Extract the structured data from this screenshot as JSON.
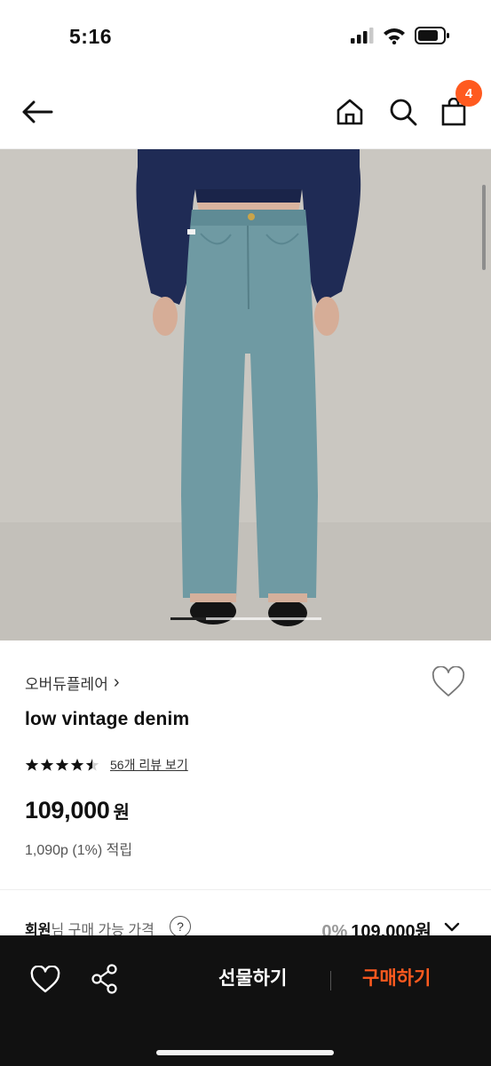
{
  "status": {
    "time": "5:16"
  },
  "nav": {
    "cart_count": "4"
  },
  "product": {
    "brand": "오버듀플레어",
    "brand_chevron": "›",
    "name": "low vintage denim",
    "rating": 4.5,
    "review_link": "56개 리뷰 보기",
    "price": "109,000",
    "price_unit": "원",
    "points": "1,090p (1%) 적립",
    "image_index": 1
  },
  "member_price": {
    "label_bold": "회원",
    "label_rest": "님 구매 가능 가격",
    "help": "?",
    "discount": "0%",
    "price": "109,000원"
  },
  "bottom_bar": {
    "gift_label": "선물하기",
    "buy_label": "구매하기"
  },
  "colors": {
    "accent": "#ff5a1f",
    "bottom_bar": "#111111",
    "image_bg": "#c8c6c0",
    "denim": "#6f9aa3",
    "sweater": "#1f2b55"
  }
}
